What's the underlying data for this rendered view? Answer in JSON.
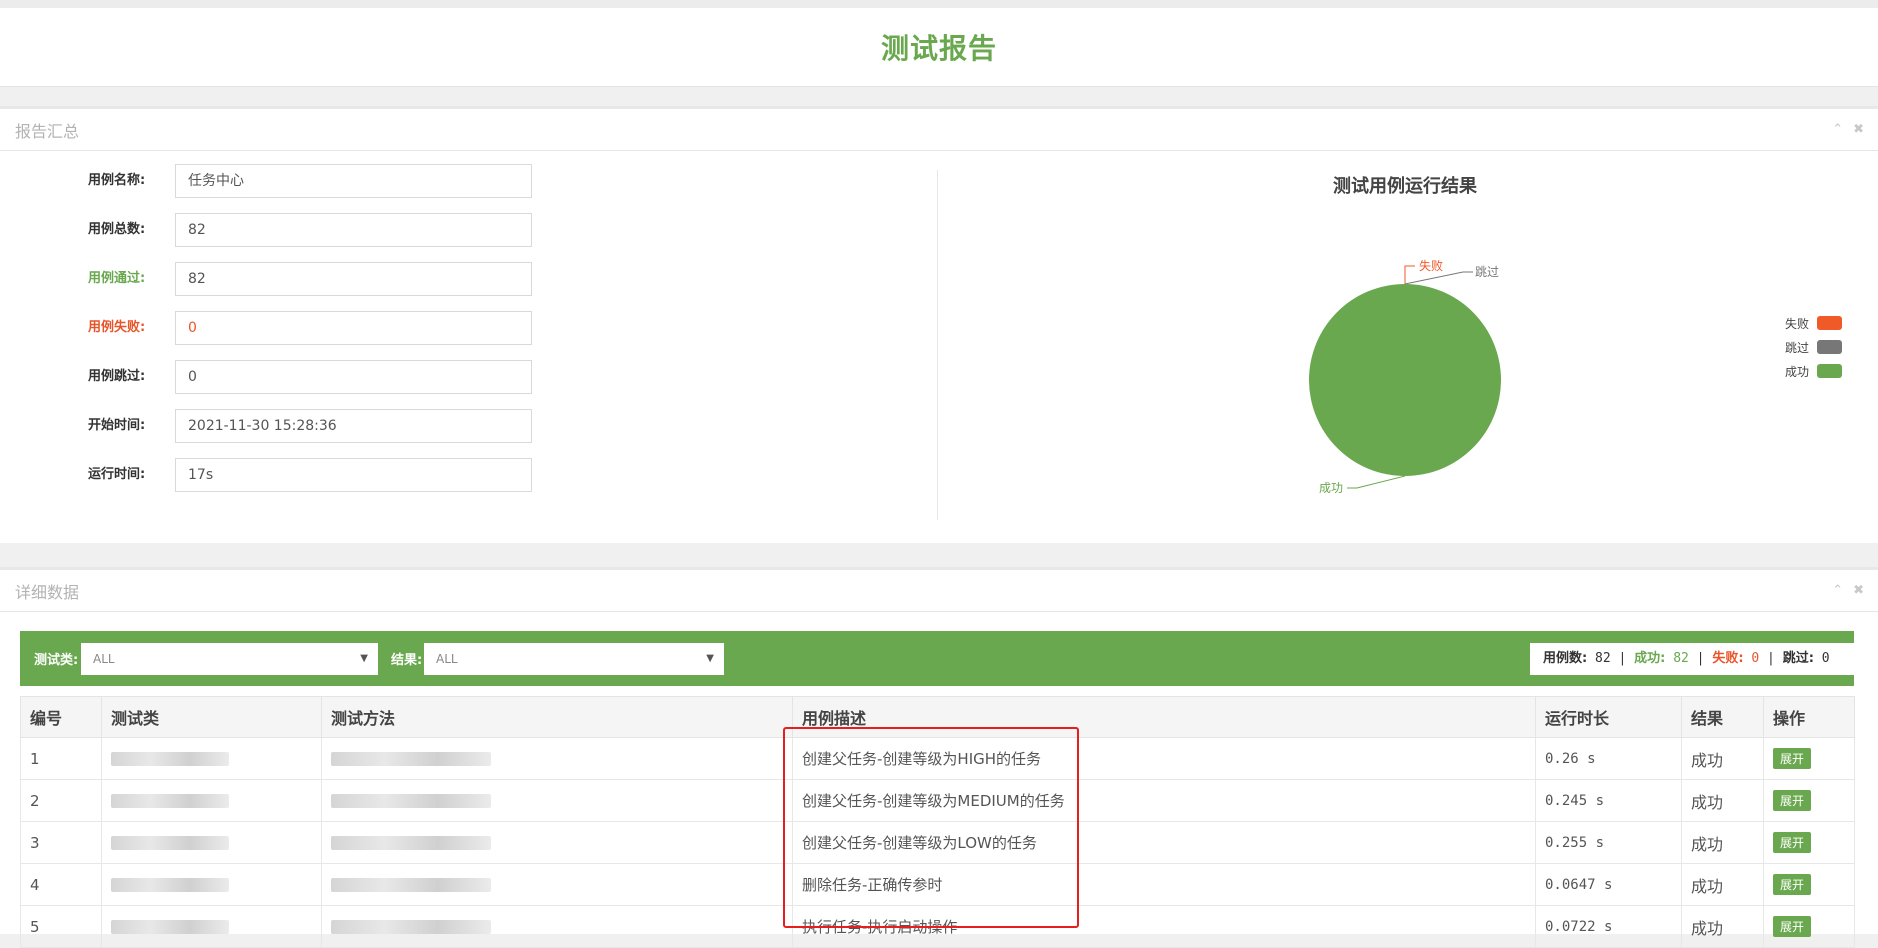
{
  "page_title": "测试报告",
  "summary": {
    "title": "报告汇总",
    "fields": [
      {
        "label": "用例名称:",
        "value": "任务中心"
      },
      {
        "label": "用例总数:",
        "value": "82"
      },
      {
        "label": "用例通过:",
        "value": "82"
      },
      {
        "label": "用例失败:",
        "value": "0"
      },
      {
        "label": "用例跳过:",
        "value": "0"
      },
      {
        "label": "开始时间:",
        "value": "2021-11-30 15:28:36"
      },
      {
        "label": "运行时间:",
        "value": "17s"
      }
    ]
  },
  "panel_tools": {
    "collapse_icon": "chevron-up-icon",
    "close_icon": "close-icon"
  },
  "chart_data": {
    "type": "pie",
    "title": "测试用例运行结果",
    "categories": [
      "失败",
      "跳过",
      "成功"
    ],
    "values": [
      0,
      0,
      82
    ],
    "colors": [
      "#f05a28",
      "#777777",
      "#6aa84f"
    ],
    "legend": "right"
  },
  "detail": {
    "title": "详细数据",
    "filter": {
      "class_label": "测试类:",
      "class_value": "ALL",
      "result_label": "结果:",
      "result_value": "ALL"
    },
    "stats": {
      "total_label": "用例数:",
      "total": "82",
      "pass_label": "成功:",
      "pass": "82",
      "fail_label": "失败:",
      "fail": "0",
      "skip_label": "跳过:",
      "skip": "0"
    },
    "columns": [
      "编号",
      "测试类",
      "测试方法",
      "用例描述",
      "运行时长",
      "结果",
      "操作"
    ],
    "rows": [
      {
        "id": "1",
        "desc": "创建父任务-创建等级为HIGH的任务",
        "duration": "0.26 s",
        "result": "成功",
        "action": "展开"
      },
      {
        "id": "2",
        "desc": "创建父任务-创建等级为MEDIUM的任务",
        "duration": "0.245 s",
        "result": "成功",
        "action": "展开"
      },
      {
        "id": "3",
        "desc": "创建父任务-创建等级为LOW的任务",
        "duration": "0.255 s",
        "result": "成功",
        "action": "展开"
      },
      {
        "id": "4",
        "desc": "删除任务-正确传参时",
        "duration": "0.0647 s",
        "result": "成功",
        "action": "展开"
      },
      {
        "id": "5",
        "desc": "执行任务-执行启动操作",
        "duration": "0.0722 s",
        "result": "成功",
        "action": "展开"
      }
    ]
  }
}
